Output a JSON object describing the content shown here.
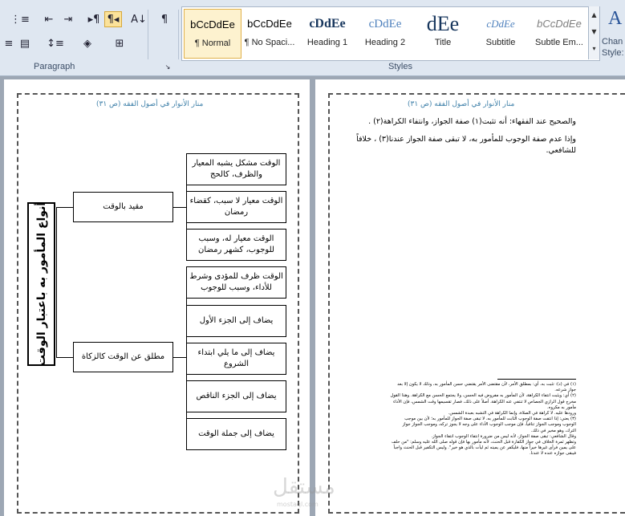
{
  "ribbon": {
    "paragraph_group_label": "Paragraph",
    "styles_group_label": "Styles",
    "change_styles_label_1": "Chan",
    "change_styles_label_2": "Style:",
    "styles": [
      {
        "preview": "bCcDdEe",
        "name": "¶ Normal",
        "selected": true
      },
      {
        "preview": "bCcDdEe",
        "name": "¶ No Spaci..."
      },
      {
        "preview": "cDdEe",
        "name": "Heading 1"
      },
      {
        "preview": "cDdEe",
        "name": "Heading 2"
      },
      {
        "preview": "dEe",
        "name": "Title"
      },
      {
        "preview": "cDdEe",
        "name": "Subtitle"
      },
      {
        "preview": "bCcDdEe",
        "name": "Subtle Em..."
      }
    ],
    "icons": {
      "numbering": "numbering-icon",
      "multilevel": "multilevel-list-icon",
      "decrease_indent": "decrease-indent-icon",
      "increase_indent": "increase-indent-icon",
      "ltr": "left-to-right-icon",
      "rtl": "right-to-left-icon",
      "sort": "sort-icon",
      "show_marks": "pilcrow-icon",
      "align": "align-icon",
      "justify": "justify-icon",
      "line_spacing": "line-spacing-icon",
      "shading": "shading-icon",
      "borders": "borders-icon"
    }
  },
  "left_page": {
    "header": "منار الأنوار في أصول الفقه  (ص ٣١)",
    "title": "أنواع المأمور به باعتبار الوقت",
    "branch_1": "مقيد بالوقت",
    "branch_2": "مطلق عن الوقت كالزكاة",
    "leaves_1": [
      "الوقت مشكل يشبه المعيار والظرف، كالحج",
      "الوقت معيار لا سبب، كقضاء رمضان",
      "الوقت معيار له، وسبب للوجوب، كشهر رمضان"
    ],
    "leaves_2": [
      "الوقت ظرف للمؤدى وشرط للأداء، وسبب للوجوب",
      "يضاف إلى الجزء الأول",
      "يضاف إلى ما يلي ابتداء الشروع",
      "يضاف إلى الجزء الناقص",
      "يضاف إلى جملة الوقت"
    ]
  },
  "right_page": {
    "header": "منار الأنوار في أصول الفقه  (ص ٣١)",
    "body_line_1": "والصحيح عند الفقهاء: أنه تثبت(١) صفة الجواز، وانتفاء الكراهة(٢) .",
    "body_line_2": "وإذا عدم صفة الوجوب للمأمور به، لا تبقى صفة الجواز عندنا(٣) ، خلافاً",
    "body_line_3": "للشافعي.",
    "footnotes": [
      "(١) في (د): تثبت به، أي: بمطلق الأمر، لأن مقتضى الأمر يقتضي حسن المأمور به، وذلك لا يكون إلا بعد",
      "جواز شرعه.",
      "(٢) أي: ويثبت انتفاء الكراهة، لأن المأمور به مفروض فيه الحسن، ولا يجتمع الحسن مع الكراهة. وهذا القول",
      "مخرج قول الرازي الجصاص لا تنتفي عنه الكراهة، أصلاً على ذلك، فصار تقسيمها وقت الشمس، فإن الأداء",
      "مأمور به مكروه.",
      "ورودها عليه. لا كراهة في الصلاة، وإنما الكراهة في التشبه بعبدة الشمس.",
      "(٣) يعني: إذا انتفت صفة الوجوب الثابت للمأمور به، لا تبقى صفة الجواز للمأمور به؛ لأن بين موجب",
      "الوجوب وموجب الجواز تنافياً، فإن موجب الوجوب الأداء على وجه لا يجوز تركه، وموجب الجواز جواز",
      "الترك، وهو مخير في ذلك.",
      "وقال الشافعي: تبقى صفة الجواز، لأنه ليس من ضرورة انتفاء الوجوب انتفاء الجواز.",
      "وتظهر ثمرة الخلاف في جواز الكفارة قبل الحنث، لأنه مأمور بها فإن قوله صلى الله عليه وسلم: \"من حلف",
      "على يمين فرأى غيرها خيراً منها، فليكفر عن يمينه ثم ليأت بالذي هو خير\". وليس التكفير قبل الحنث واجباً",
      "فيبقى جوازه عنده لا عندنا."
    ]
  },
  "watermark": {
    "text": "مستقل",
    "url": "mostaql.com"
  }
}
